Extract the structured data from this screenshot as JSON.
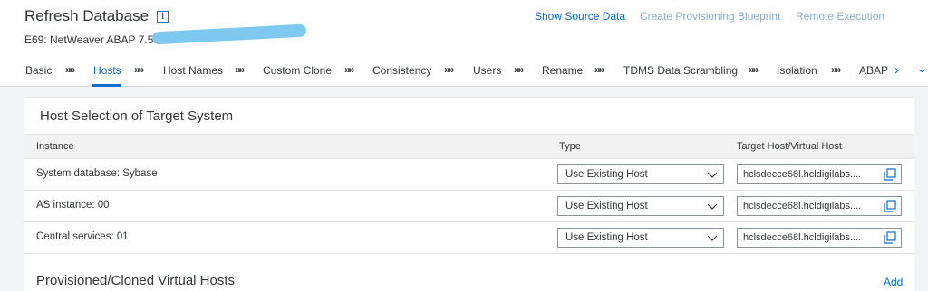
{
  "header": {
    "title": "Refresh Database",
    "subtitle": "E69: NetWeaver ABAP 7.53",
    "info_icon": "info-icon",
    "actions": {
      "show_source": "Show Source Data",
      "create_blueprint": "Create Provisioning Blueprint",
      "remote_execution": "Remote Execution"
    }
  },
  "tabs": [
    {
      "label": "Basic",
      "selected": false
    },
    {
      "label": "Hosts",
      "selected": true
    },
    {
      "label": "Host Names",
      "selected": false
    },
    {
      "label": "Custom Clone",
      "selected": false
    },
    {
      "label": "Consistency",
      "selected": false
    },
    {
      "label": "Users",
      "selected": false
    },
    {
      "label": "Rename",
      "selected": false
    },
    {
      "label": "TDMS Data Scrambling",
      "selected": false
    },
    {
      "label": "Isolation",
      "selected": false
    },
    {
      "label": "ABAP",
      "selected": false
    }
  ],
  "tab_separator": "»",
  "tab_controls": {
    "scroll": "›",
    "overflow": "⌄"
  },
  "section": {
    "title": "Host Selection of Target System",
    "columns": [
      "Instance",
      "Type",
      "Target Host/Virtual Host"
    ],
    "rows": [
      {
        "instance": "System database: Sybase",
        "type": "Use Existing Host",
        "target_host": "hclsdecce68l.hcldigilabs...."
      },
      {
        "instance": "AS instance: 00",
        "type": "Use Existing Host",
        "target_host": "hclsdecce68l.hcldigilabs...."
      },
      {
        "instance": "Central services: 01",
        "type": "Use Existing Host",
        "target_host": "hclsdecce68l.hcldigilabs...."
      }
    ]
  },
  "section2": {
    "title": "Provisioned/Cloned Virtual Hosts",
    "add_label": "Add"
  },
  "colors": {
    "accent": "#0a6ed1",
    "muted_link": "#8aaecf",
    "background": "#f3f4f5",
    "redaction": "#7dc9ef"
  }
}
